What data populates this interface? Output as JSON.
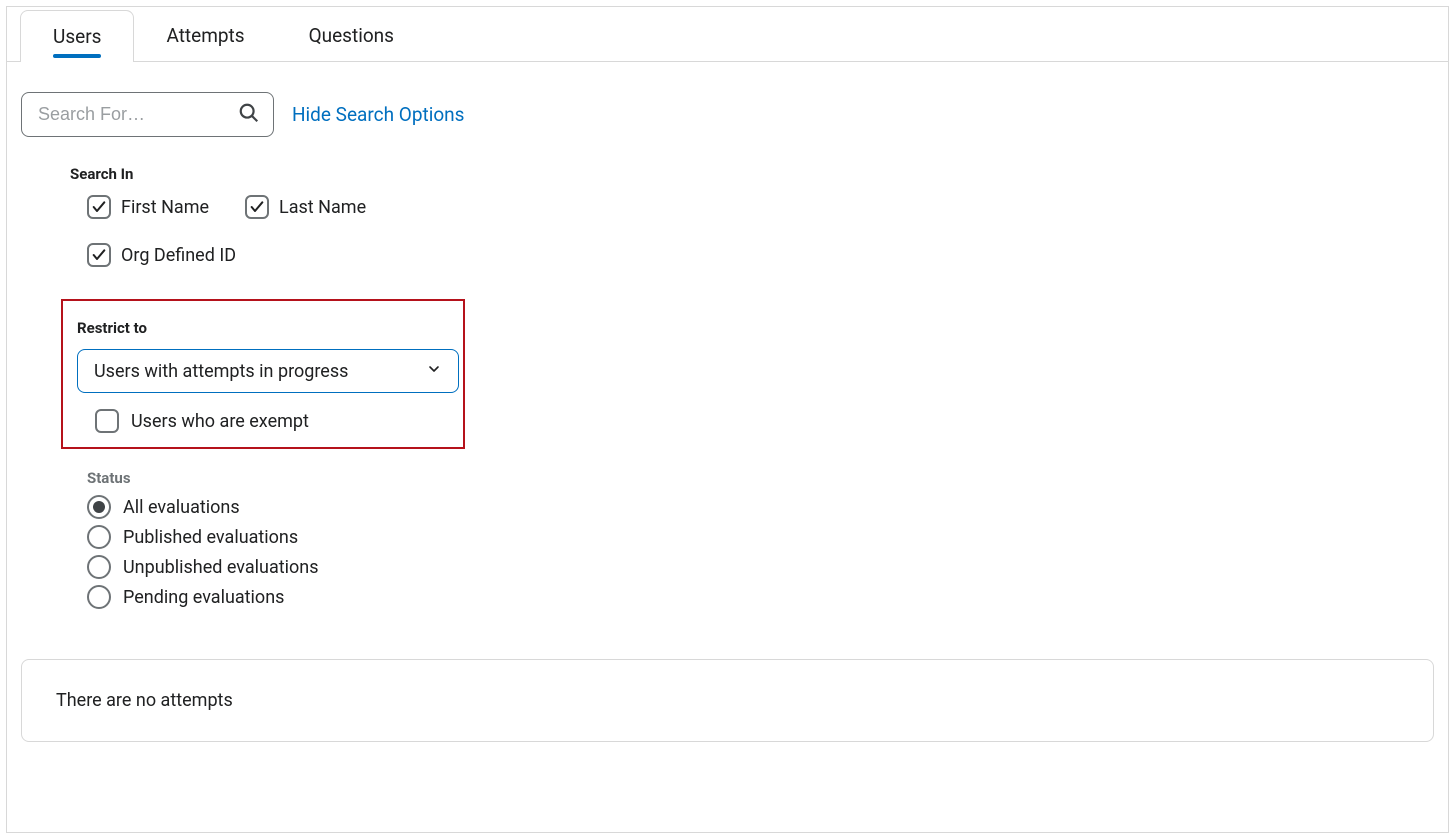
{
  "tabs": [
    {
      "label": "Users",
      "active": true
    },
    {
      "label": "Attempts",
      "active": false
    },
    {
      "label": "Questions",
      "active": false
    }
  ],
  "search": {
    "placeholder": "Search For…",
    "value": "",
    "hide_options_label": "Hide Search Options"
  },
  "search_in": {
    "title": "Search In",
    "first_name": {
      "label": "First Name",
      "checked": true
    },
    "last_name": {
      "label": "Last Name",
      "checked": true
    },
    "org_id": {
      "label": "Org Defined ID",
      "checked": true
    }
  },
  "restrict": {
    "title": "Restrict to",
    "selected": "Users with attempts in progress",
    "exempt": {
      "label": "Users who are exempt",
      "checked": false
    }
  },
  "status": {
    "title": "Status",
    "options": [
      {
        "label": "All evaluations",
        "selected": true
      },
      {
        "label": "Published evaluations",
        "selected": false
      },
      {
        "label": "Unpublished evaluations",
        "selected": false
      },
      {
        "label": "Pending evaluations",
        "selected": false
      }
    ]
  },
  "message": "There are no attempts"
}
